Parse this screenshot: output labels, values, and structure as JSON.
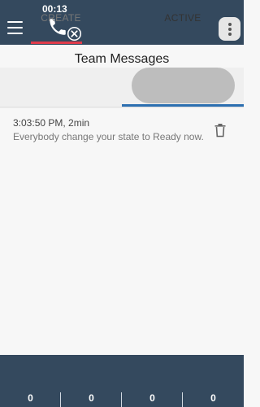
{
  "header": {
    "call_timer": "00:13",
    "icons": {
      "menu": "hamburger-menu-icon",
      "call": "phone-icon",
      "hangup": "close-circle-icon",
      "more": "more-vertical-icon"
    },
    "colors": {
      "bar": "#34495e",
      "call_indicator": "#e03b4b"
    }
  },
  "page": {
    "title": "Team Messages"
  },
  "tabs": [
    {
      "label": "CREATE",
      "selected": false
    },
    {
      "label": "ACTIVE",
      "selected": true
    }
  ],
  "tab_indicator_color": "#2c6fb0",
  "messages": [
    {
      "time": "3:03:50 PM, 2min",
      "text": "Everybody change your state to Ready now.",
      "action_icon": "trash-icon"
    }
  ],
  "footer": {
    "stats": [
      {
        "value": "0"
      },
      {
        "value": "0"
      },
      {
        "value": "0"
      },
      {
        "value": "0"
      }
    ]
  }
}
